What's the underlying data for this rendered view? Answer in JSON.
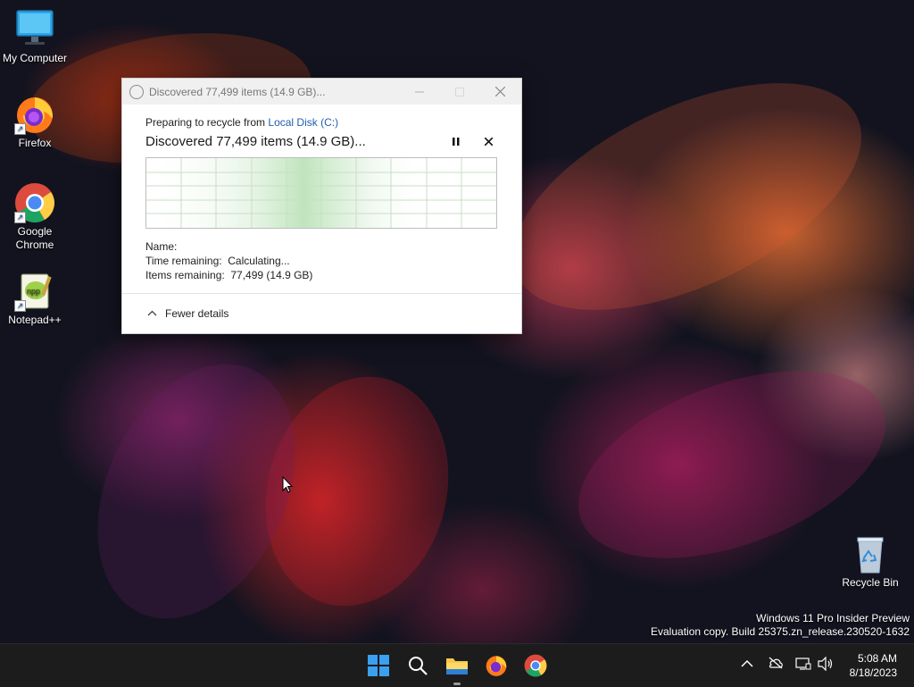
{
  "desktop": {
    "icons": [
      {
        "label": "My Computer"
      },
      {
        "label": "Firefox"
      },
      {
        "label": "Google Chrome"
      },
      {
        "label": "Notepad++"
      }
    ],
    "recycle_bin": {
      "label": "Recycle Bin"
    }
  },
  "dialog": {
    "title": "Discovered 77,499 items (14.9 GB)...",
    "prep_prefix": "Preparing to recycle from ",
    "prep_link": "Local Disk (C:)",
    "headline": "Discovered 77,499 items (14.9 GB)...",
    "pause_icon": "pause-icon",
    "cancel_icon": "close-icon",
    "name_label": "Name:",
    "time_label": "Time remaining:",
    "time_value": "Calculating...",
    "items_label": "Items remaining:",
    "items_value": "77,499 (14.9 GB)",
    "fewer_details": "Fewer details"
  },
  "watermark": {
    "line1": "Windows 11 Pro Insider Preview",
    "line2": "Evaluation copy. Build 25375.zn_release.230520-1632"
  },
  "taskbar": {
    "apps": [
      "start-icon",
      "search-icon",
      "file-explorer-icon",
      "firefox-icon",
      "chrome-icon"
    ],
    "time": "5:08 AM",
    "date": "8/18/2023"
  },
  "colors": {
    "accent_link": "#1f5fb0",
    "progress_green": "#06b025",
    "taskbar_bg": "#1c1c1c"
  }
}
